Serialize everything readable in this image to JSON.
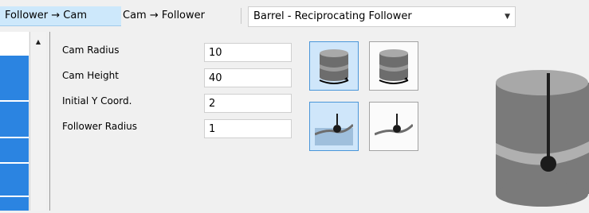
{
  "tabs": [
    {
      "label": "Follower → Cam",
      "selected": true
    },
    {
      "label": "Cam → Follower",
      "selected": false
    }
  ],
  "cam_type_select": {
    "value": "Barrel - Reciprocating Follower"
  },
  "parameters": [
    {
      "label": "Cam Radius",
      "value": "10"
    },
    {
      "label": "Cam Height",
      "value": "40"
    },
    {
      "label": "Initial Y Coord.",
      "value": "2"
    },
    {
      "label": "Follower Radius",
      "value": "1"
    }
  ],
  "mode_buttons": [
    {
      "icon": "barrel-cam-rotate-icon",
      "selected": true
    },
    {
      "icon": "barrel-cam-rotate-alt-icon",
      "selected": false
    },
    {
      "icon": "follower-on-curve-icon",
      "selected": true
    },
    {
      "icon": "follower-on-curve-alt-icon",
      "selected": false
    }
  ],
  "colors": {
    "accent": "#2b84e1",
    "tab_selected": "#cde8fb",
    "button_selected": "#cfe6fa",
    "cam_gray": "#7a7a7a"
  }
}
